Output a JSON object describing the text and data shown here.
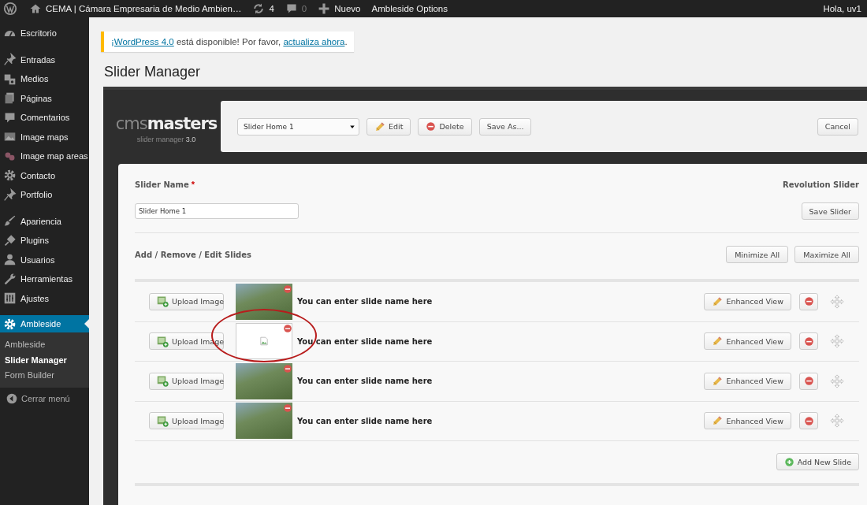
{
  "admin_bar": {
    "site_title": "CEMA | Cámara Empresaria de Medio Ambien…",
    "updates": "4",
    "comments": "0",
    "new_label": "Nuevo",
    "options": "Ambleside Options",
    "greeting": "Hola, uv1"
  },
  "sidebar": {
    "groups": [
      [
        {
          "label": "Escritorio",
          "selected": false
        }
      ],
      [
        {
          "label": "Entradas",
          "selected": false
        },
        {
          "label": "Medios",
          "selected": false
        },
        {
          "label": "Páginas",
          "selected": false
        },
        {
          "label": "Comentarios",
          "selected": false
        },
        {
          "label": "Image maps",
          "selected": false
        },
        {
          "label": "Image map areas",
          "selected": false
        },
        {
          "label": "Contacto",
          "selected": false
        },
        {
          "label": "Portfolio",
          "selected": false
        }
      ],
      [
        {
          "label": "Apariencia",
          "selected": false
        },
        {
          "label": "Plugins",
          "selected": false
        },
        {
          "label": "Usuarios",
          "selected": false
        },
        {
          "label": "Herramientas",
          "selected": false
        },
        {
          "label": "Ajustes",
          "selected": false
        }
      ],
      [
        {
          "label": "Ambleside",
          "selected": true
        }
      ]
    ],
    "submenu": [
      {
        "label": "Ambleside",
        "selected": false
      },
      {
        "label": "Slider Manager",
        "selected": true
      },
      {
        "label": "Form Builder",
        "selected": false
      }
    ],
    "collapse": "Cerrar menú"
  },
  "notice": {
    "parts": [
      {
        "kind": "link",
        "text": "¡WordPress 4.0"
      },
      {
        "kind": "text",
        "text": " está disponible! Por favor, "
      },
      {
        "kind": "link",
        "text": "actualiza ahora"
      },
      {
        "kind": "text",
        "text": "."
      }
    ]
  },
  "page_title": "Slider Manager",
  "plugin": {
    "logo_light": "cms",
    "logo_bold": "masters",
    "subtitle": "slider manager",
    "version": "3.0",
    "toolbar": {
      "slider_select": "Slider Home 1",
      "edit": "Edit",
      "delete": "Delete",
      "save_as": "Save As...",
      "cancel": "Cancel"
    },
    "form": {
      "name_label": "Slider Name",
      "required": "*",
      "slider_type": "Revolution Slider",
      "name_value": "Slider Home 1",
      "save": "Save Slider",
      "section_title": "Add / Remove / Edit Slides",
      "minimize": "Minimize All",
      "maximize": "Maximize All"
    },
    "slides": [
      {
        "upload": "Upload Image",
        "kind": "photo",
        "name": "You can enter slide name here",
        "enhanced": "Enhanced View",
        "annotated": false
      },
      {
        "upload": "Upload Image",
        "kind": "broken",
        "name": "You can enter slide name here",
        "enhanced": "Enhanced View",
        "annotated": true
      },
      {
        "upload": "Upload Image",
        "kind": "photo",
        "name": "You can enter slide name here",
        "enhanced": "Enhanced View",
        "annotated": false
      },
      {
        "upload": "Upload Image",
        "kind": "photo",
        "name": "You can enter slide name here",
        "enhanced": "Enhanced View",
        "annotated": false
      }
    ],
    "add_slide": "Add New Slide"
  }
}
